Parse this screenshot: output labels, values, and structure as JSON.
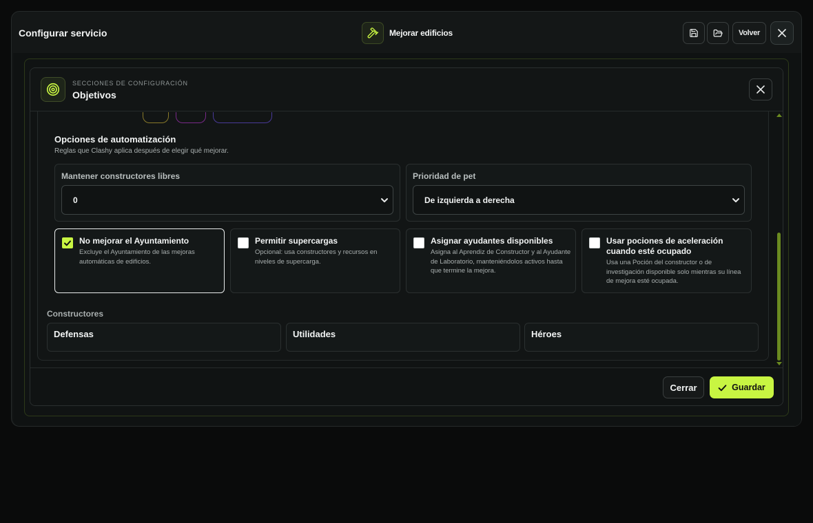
{
  "window": {
    "title": "Configurar servicio",
    "service_name": "Mejorar edificios",
    "service_icon": "hammer-icon",
    "back_label": "Volver"
  },
  "modal": {
    "kicker": "Secciones de configuración",
    "title": "Objetivos",
    "icon": "target-icon"
  },
  "automation": {
    "title": "Opciones de automatización",
    "subtitle": "Reglas que Clashy aplica después de elegir qué mejorar.",
    "keep_builders": {
      "label": "Mantener constructores libres",
      "value": "0"
    },
    "pet_priority": {
      "label": "Prioridad de pet",
      "value": "De izquierda a derecha"
    },
    "options": [
      {
        "title": "No mejorar el Ayuntamiento",
        "description": "Excluye el Ayuntamiento de las mejoras automáticas de edificios.",
        "checked": true
      },
      {
        "title": "Permitir supercargas",
        "description": "Opcional: usa constructores y recursos en niveles de supercarga.",
        "checked": false
      },
      {
        "title": "Asignar ayudantes disponibles",
        "description": "Asigna al Aprendiz de Constructor y al Ayudante de Laboratorio, manteniéndolos activos hasta que termine la mejora.",
        "checked": false
      },
      {
        "title": "Usar pociones de aceleración cuando esté ocupado",
        "description": "Usa una Poción del constructor o de investigación disponible solo mientras su línea de mejora esté ocupada.",
        "checked": false
      }
    ]
  },
  "builders": {
    "label": "Constructores",
    "tabs": [
      "Defensas",
      "Utilidades",
      "Héroes"
    ]
  },
  "footer": {
    "close_label": "Cerrar",
    "save_label": "Guardar"
  },
  "colors": {
    "accent": "#c8f542",
    "background": "#0a0b0b",
    "pill_yellow": "#8a7a2a",
    "pill_magenta": "#7a2a8a",
    "pill_purple": "#4a3a9a"
  }
}
